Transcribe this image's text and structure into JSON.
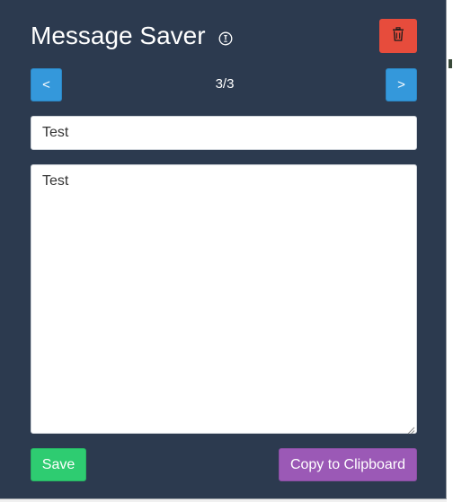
{
  "app": {
    "title": "Message Saver"
  },
  "icons": {
    "info": "info-circle-icon",
    "delete": "trash-icon"
  },
  "navigation": {
    "prev_label": "<",
    "next_label": ">",
    "counter": "3/3",
    "current": 3,
    "total": 3
  },
  "form": {
    "title_value": "Test",
    "message_value": "Test"
  },
  "actions": {
    "save_label": "Save",
    "copy_label": "Copy to Clipboard"
  },
  "colors": {
    "background": "#2c3a4f",
    "delete": "#e74c3c",
    "nav": "#3498db",
    "save": "#2ecc71",
    "copy": "#9b59b6"
  }
}
